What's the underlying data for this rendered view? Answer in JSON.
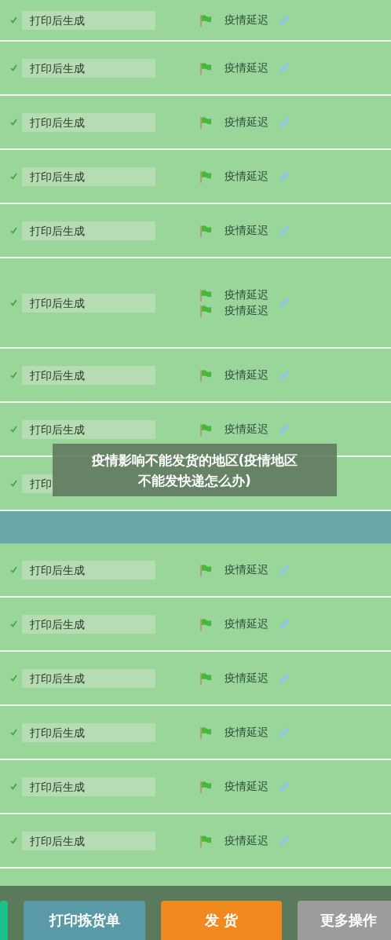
{
  "rows": [
    {
      "kind": "order",
      "checked": true,
      "field": "打印后生成",
      "tags": [
        "疫情延迟"
      ]
    },
    {
      "kind": "order",
      "checked": true,
      "field": "打印后生成",
      "tags": [
        "疫情延迟"
      ]
    },
    {
      "kind": "order",
      "checked": true,
      "field": "打印后生成",
      "tags": [
        "疫情延迟"
      ]
    },
    {
      "kind": "order",
      "checked": true,
      "field": "打印后生成",
      "tags": [
        "疫情延迟"
      ]
    },
    {
      "kind": "order",
      "checked": true,
      "field": "打印后生成",
      "tags": [
        "疫情延迟"
      ]
    },
    {
      "kind": "order",
      "checked": true,
      "field": "打印后生成",
      "tags": [
        "疫情延迟",
        "疫情延迟"
      ]
    },
    {
      "kind": "order",
      "checked": true,
      "field": "打印后生成",
      "tags": [
        "疫情延迟"
      ]
    },
    {
      "kind": "order",
      "checked": true,
      "field": "打印后生成",
      "tags": [
        "疫情延迟"
      ]
    },
    {
      "kind": "covered",
      "checked": true,
      "field": "打印"
    },
    {
      "kind": "band"
    },
    {
      "kind": "order",
      "checked": true,
      "field": "打印后生成",
      "tags": [
        "疫情延迟"
      ]
    },
    {
      "kind": "order",
      "checked": true,
      "field": "打印后生成",
      "tags": [
        "疫情延迟"
      ]
    },
    {
      "kind": "order",
      "checked": true,
      "field": "打印后生成",
      "tags": [
        "疫情延迟"
      ]
    },
    {
      "kind": "order",
      "checked": true,
      "field": "打印后生成",
      "tags": [
        "疫情延迟"
      ]
    },
    {
      "kind": "order",
      "checked": true,
      "field": "打印后生成",
      "tags": [
        "疫情延迟"
      ]
    },
    {
      "kind": "order",
      "checked": true,
      "field": "打印后生成",
      "tags": [
        "疫情延迟"
      ]
    }
  ],
  "caption": {
    "lines": [
      "疫情影响不能发货的地区(疫情地区",
      "不能发快递怎么办)"
    ]
  },
  "action_bar": {
    "buttons": [
      {
        "kind": "sliver"
      },
      {
        "kind": "secondary",
        "label": "打印拣货单"
      },
      {
        "kind": "primary",
        "label": "发 货"
      },
      {
        "kind": "more",
        "label": "更多操作"
      }
    ]
  }
}
